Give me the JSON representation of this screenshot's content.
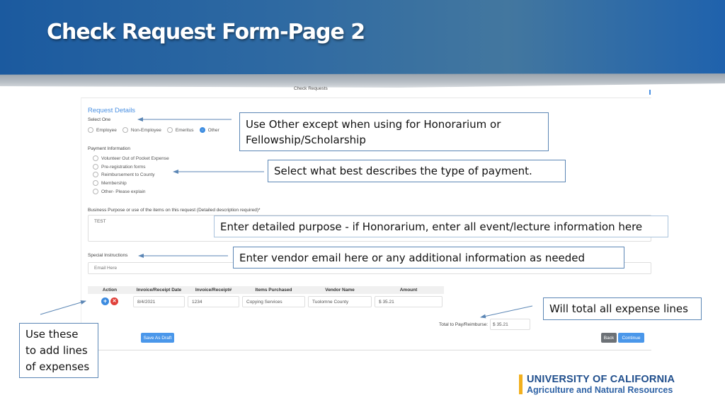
{
  "slide": {
    "title": "Check Request Form-Page 2"
  },
  "form": {
    "window_title": "Check Requests",
    "section_title": "Request Details",
    "select_one_label": "Select One",
    "employee_options": [
      {
        "label": "Employee",
        "checked": false
      },
      {
        "label": "Non-Employee",
        "checked": false
      },
      {
        "label": "Emeritus",
        "checked": false
      },
      {
        "label": "Other",
        "checked": true
      }
    ],
    "payment_info_label": "Payment Information",
    "payment_options": [
      {
        "label": "Volunteer Out of Pocket Expense",
        "checked": false
      },
      {
        "label": "Pre-registration forms",
        "checked": false
      },
      {
        "label": "Reimbursement to County",
        "checked": false
      },
      {
        "label": "Membership",
        "checked": false
      },
      {
        "label": "Other- Please explain",
        "checked": false
      }
    ],
    "business_purpose_label": "Business Purpose or use of the items on this request (Detailed description required)*",
    "business_purpose_value": "TEST",
    "special_instructions_label": "Special Instructions",
    "special_instructions_placeholder": "Email Here",
    "table": {
      "headers": [
        "Action",
        "Invoice/Receipt Date",
        "Invoice/Receipt#",
        "Items Purchased",
        "Vendor Name",
        "Amount"
      ],
      "rows": [
        {
          "date": "8/4/2021",
          "receipt": "1234",
          "items": "Copying Services",
          "vendor": "Tuolomne County",
          "currency": "$",
          "amount": "35.21"
        }
      ]
    },
    "total_label": "Total to Pay/Reimburse:",
    "total_currency": "$",
    "total_value": "35.21",
    "buttons": {
      "save_draft": "Save As Draft",
      "back": "Back",
      "continue": "Continue"
    }
  },
  "callouts": {
    "other": "Use Other except when using for Honorarium or Fellowship/Scholarship",
    "payment": "Select what best describes the type of payment.",
    "purpose": "Enter detailed purpose - if Honorarium, enter all event/lecture information here",
    "vendor": "Enter vendor email here or any additional information as needed",
    "total": "Will total all expense lines",
    "lines": "Use these to add lines of expenses"
  },
  "logo": {
    "line1": "UNIVERSITY OF CALIFORNIA",
    "line2": "Agriculture and Natural Resources"
  },
  "colors": {
    "banner_blue": "#1b5a9f",
    "form_accent": "#4a90e2",
    "callout_border": "#5b86b5",
    "logo_gold": "#f2b01e",
    "logo_blue": "#1f4e8c"
  }
}
